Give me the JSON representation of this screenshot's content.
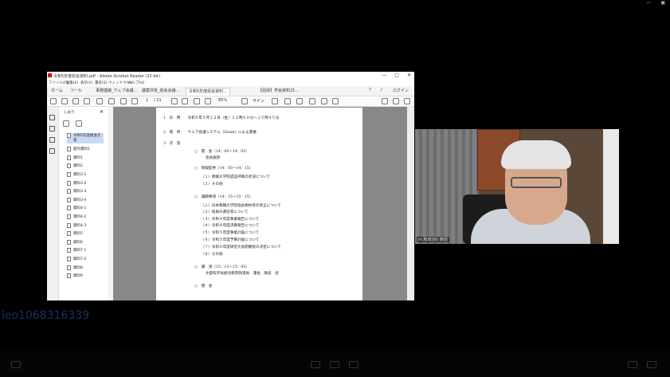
{
  "app": {
    "window_title": "令和5年度総会資料.pdf - Adobe Acrobat Reader (32-bit)",
    "menu": [
      "ファイル(F)",
      "編集(E)",
      "表示(V)",
      "署名(S)",
      "ウィンドウ(W)",
      "ヘルプ(H)"
    ],
    "tabs": [
      "ホーム",
      "ツール",
      "事務連絡_ウェブ会議...",
      "議案共有_総会会議...",
      "令和5年度総会資料...",
      "【別添】学会資料21..."
    ],
    "active_tab_index": 4,
    "help_icon": "?",
    "login_label": "ログイン",
    "page_current": "1",
    "page_total": "/ 21",
    "zoom": "85%",
    "fit_label": "サイン"
  },
  "bookmarks": {
    "title": "しおり",
    "close_glyph": "✕",
    "items": [
      "令和5年度総会次第",
      "配付資料1",
      "資料1",
      "資料2",
      "資料3-1",
      "資料3-2",
      "資料3-3",
      "資料3-4",
      "資料4-1",
      "資料4-2",
      "資料4-3",
      "資料5",
      "資料6",
      "資料7-1",
      "資料7-2",
      "資料8",
      "資料9"
    ],
    "selected_index": 0
  },
  "document": {
    "lines": [
      "1　日　時　　令和５年５月１２日（金）１２時００分～１５時４５分",
      "2　場　所　　ウェブ会議システム（Zoom）による開催",
      "3　次　第",
      "○　開　会（14：00～14：05）",
      "会長挨拶",
      "○　情報提供（14：05～14：15）",
      "（１）教職大学院認証評価の状況について",
      "（２）その他",
      "○　議題事項（14：15～15：15）",
      "（１）日本教職大学院協会規約等の改正について",
      "（２）役員の選任等について",
      "（３）令和４年度事業報告について",
      "（４）令和４年度決算報告について",
      "（５）令和５年度事業計画について",
      "（６）令和５年度予算計画について",
      "（７）令和６年度研究大会開催校の決定について",
      "（８）その他",
      "○　講　演（15：15～15：45）",
      "文部科学省総合教育政策局　課長　隣良　武",
      "○　閉　会"
    ]
  },
  "webcam": {
    "participant_name": "m.和田(仮) 教授"
  },
  "meeting_id": "leo1068316339",
  "colors": {
    "background": "#000000",
    "bookmark_selected": "#c9daf2",
    "meeting_id": "#1b2f66"
  }
}
